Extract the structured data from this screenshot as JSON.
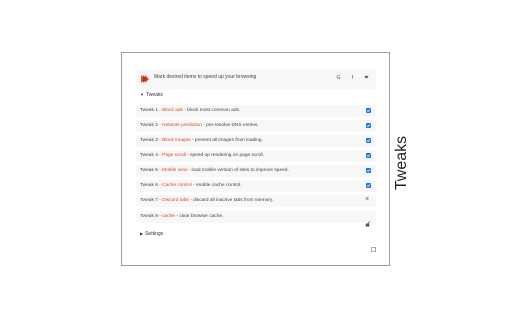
{
  "panel": {
    "header_text": "Mark desired items to speed up your browsing",
    "header_buttons": [
      "G",
      "f",
      "❤"
    ],
    "tweaks_section_label": "Tweaks",
    "settings_section_label": "Settings",
    "tweaks": [
      {
        "prefix": "Tweak 1 - ",
        "name": "Block ads",
        "desc": " - block most common ads.",
        "control": "checkbox",
        "checked": true
      },
      {
        "prefix": "Tweak 2 - ",
        "name": "Network prediction",
        "desc": " - pre-resolve DNS entries.",
        "control": "checkbox",
        "checked": true
      },
      {
        "prefix": "Tweak 3 - ",
        "name": "Block images",
        "desc": " - prevent all images from loading.",
        "control": "checkbox",
        "checked": true
      },
      {
        "prefix": "Tweak 4 - ",
        "name": "Page scroll",
        "desc": " - speed up rendering on page scroll.",
        "control": "checkbox",
        "checked": true
      },
      {
        "prefix": "Tweak 5 - ",
        "name": "Mobile view",
        "desc": " - load mobile version of sites to improve speed.",
        "control": "checkbox",
        "checked": true
      },
      {
        "prefix": "Tweak 6 - ",
        "name": "Cache control",
        "desc": " - enable cache control.",
        "control": "checkbox",
        "checked": true
      },
      {
        "prefix": "Tweak 7 - ",
        "name": "Discard tabs",
        "desc": " - discard all inactive tabs from memory.",
        "control": "close-icon"
      },
      {
        "prefix": "Tweak 8 - ",
        "name": "cache",
        "desc": " - clear browser cache.",
        "control": "broom-icon"
      }
    ]
  },
  "side_title": "Tweaks",
  "colors": {
    "accent": "#d94a1f",
    "checkbox": "#1a73e8"
  }
}
